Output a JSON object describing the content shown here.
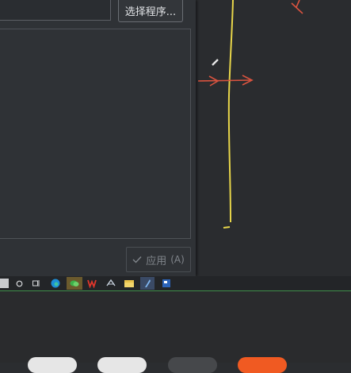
{
  "dialog": {
    "choose_program_button": "选择程序...",
    "apply_button": {
      "label": "应用",
      "mnemonic": "(A)"
    }
  },
  "taskbar": {
    "icons": [
      "search-icon",
      "task-view-icon",
      "edge-icon",
      "wechat-icon",
      "wps-icon",
      "steam-icon",
      "file-explorer-icon",
      "pen-app-icon",
      "app-icon"
    ]
  },
  "colors": {
    "accent_green": "#3f8f4a",
    "pen_red": "#d9533f",
    "pen_yellow": "#e8d64a",
    "bottom_orange": "#f05a22"
  }
}
